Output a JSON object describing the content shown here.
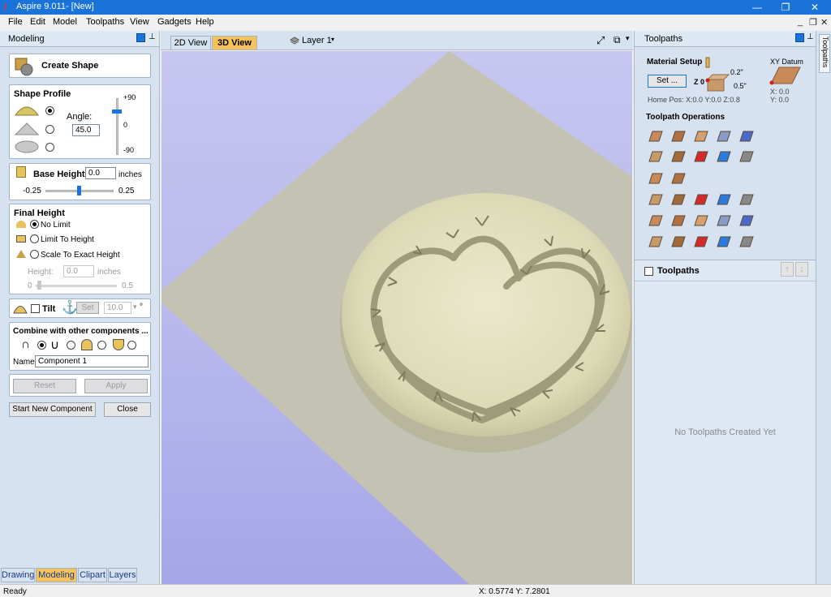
{
  "window": {
    "title": "Aspire 9.011- [New]"
  },
  "menu": {
    "items": [
      "File",
      "Edit",
      "Model",
      "Toolpaths",
      "View",
      "Gadgets",
      "Help"
    ]
  },
  "left_panel": {
    "header": "Modeling",
    "create_shape": "Create Shape",
    "shape_profile": {
      "title": "Shape Profile",
      "angle_label": "Angle:",
      "angle_value": "45.0",
      "scale_top": "+90",
      "scale_mid": "0",
      "scale_bottom": "-90",
      "selected_profile": "dome"
    },
    "base_height": {
      "label": "Base Height:",
      "value": "0.0",
      "unit": "inches",
      "min": "-0.25",
      "max": "0.25",
      "slider_fraction": 0.5
    },
    "final_height": {
      "title": "Final Height",
      "options": [
        "No Limit",
        "Limit To Height",
        "Scale To Exact Height"
      ],
      "selected": "No Limit",
      "height_label": "Height:",
      "height_value": "0.0",
      "height_unit": "inches",
      "min": "0",
      "max": "0.5"
    },
    "tilt": {
      "label": "Tilt",
      "set_label": "Set",
      "value": "10.0",
      "unit": "°"
    },
    "combine": {
      "title": "Combine with other components ...",
      "name_label": "Name",
      "name_value": "Component 1"
    },
    "buttons": {
      "reset": "Reset",
      "apply": "Apply",
      "start_new": "Start New Component",
      "close": "Close"
    },
    "tabs": [
      "Drawing",
      "Modeling",
      "Clipart",
      "Layers"
    ],
    "active_tab": "Modeling"
  },
  "view": {
    "tabs": [
      "2D View",
      "3D View"
    ],
    "active_tab": "3D View",
    "layer": "Layer 1"
  },
  "right_panel": {
    "header": "Toolpaths",
    "material_setup": {
      "title": "Material Setup",
      "set_button": "Set ...",
      "z_label": "Z 0",
      "top_offset": "0.2\"",
      "bottom_offset": "0.5\"",
      "home_pos": "Home Pos:  X:0.0 Y:0.0 Z:0.8",
      "xy_datum_label": "XY Datum",
      "x_datum": "X: 0.0",
      "y_datum": "Y: 0.0"
    },
    "operations_title": "Toolpath Operations",
    "toolpaths_title": "Toolpaths",
    "empty_message": "No Toolpaths Created Yet",
    "side_tab": "Toolpaths"
  },
  "status": {
    "left": "Ready",
    "coords": "X:  0.5774 Y:  7.2801"
  },
  "colors": {
    "accent": "#1a73d9",
    "tab_active": "#f5c35a",
    "panel_bg": "#d6e2ef",
    "model": "#d9d7b4"
  }
}
